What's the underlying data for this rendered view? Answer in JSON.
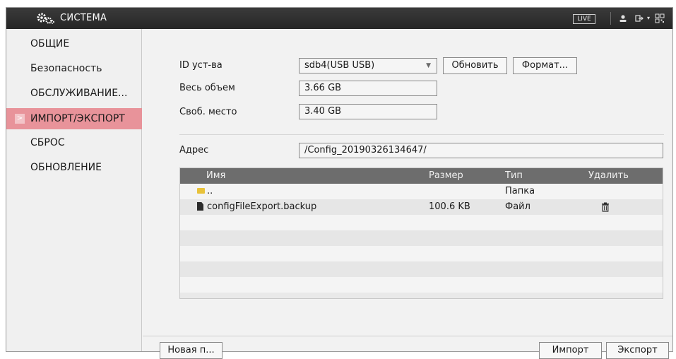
{
  "window": {
    "title": "СИСТЕМА",
    "live_label": "LIVE",
    "icons": [
      "gear-cluster-icon",
      "user-icon",
      "logout-icon",
      "qr-code-icon"
    ]
  },
  "sidebar": {
    "items": [
      {
        "label": "ОБЩИЕ",
        "active": false
      },
      {
        "label": "Безопасность",
        "active": false
      },
      {
        "label": "ОБСЛУЖИВАНИЕ...",
        "active": false
      },
      {
        "label": "ИМПОРТ/ЭКСПОРТ",
        "active": true
      },
      {
        "label": "СБРОС",
        "active": false
      },
      {
        "label": "ОБНОВЛЕНИЕ",
        "active": false
      }
    ],
    "active_arrow": ">"
  },
  "form": {
    "device_id_label": "ID уст-ва",
    "device_id_value": "sdb4(USB USB)",
    "refresh_button": "Обновить",
    "format_button": "Формат...",
    "total_label": "Весь объем",
    "total_value": "3.66 GB",
    "free_label": "Своб. место",
    "free_value": "3.40 GB",
    "address_label": "Адрес",
    "address_value": "/Config_20190326134647/"
  },
  "table": {
    "columns": [
      "Имя",
      "Размер",
      "Тип",
      "Удалить"
    ],
    "rows": [
      {
        "icon": "folder-icon",
        "name": "..",
        "size": "",
        "type": "Папка",
        "delete": false
      },
      {
        "icon": "file-icon",
        "name": "configFileExport.backup",
        "size": "100.6 KB",
        "type": "Файл",
        "delete": true
      }
    ],
    "empty_rows": 6
  },
  "footer": {
    "new_folder_button": "Новая п...",
    "import_button": "Импорт",
    "export_button": "Экспорт"
  },
  "colors": {
    "titlebar": "#2e2e2e",
    "active_item": "#e8939a",
    "table_header": "#6d6d6d",
    "folder": "#e8c23a"
  }
}
